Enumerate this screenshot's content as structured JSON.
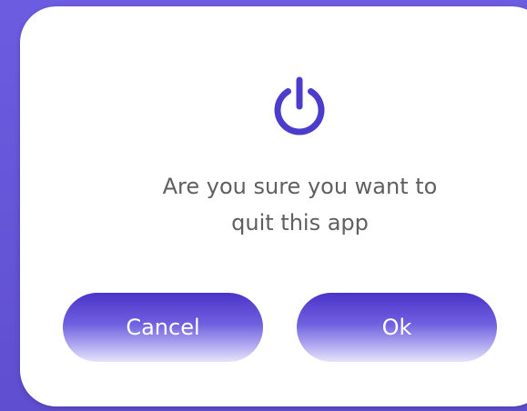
{
  "dialog": {
    "icon": "power-icon",
    "message_line1": "Are you sure you want to",
    "message_line2": "quit this app",
    "cancel_label": "Cancel",
    "ok_label": "Ok"
  },
  "colors": {
    "background": "#6a5ad6",
    "accent": "#4b3ccc",
    "button_top": "#4a34c9",
    "button_bottom": "#e6e4fb",
    "text": "#5f5f5f"
  }
}
